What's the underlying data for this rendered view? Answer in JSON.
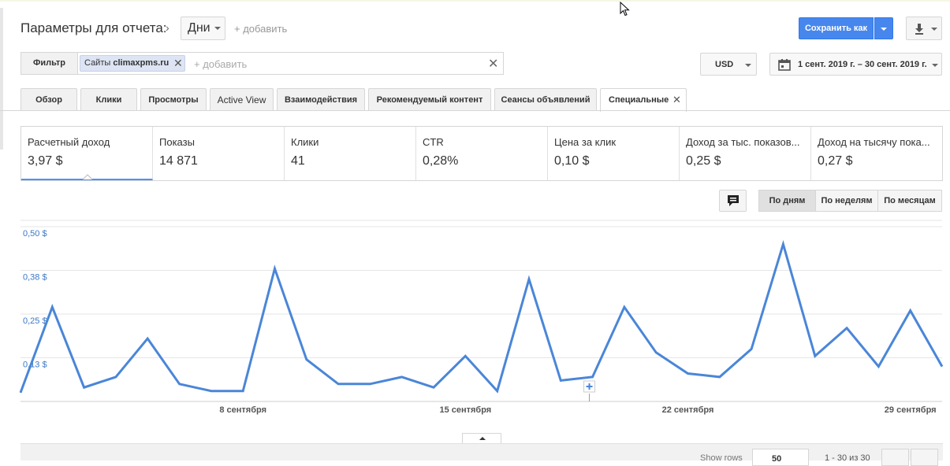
{
  "header": {
    "title": "Параметры для отчета:",
    "dimension": "Дни",
    "add_label": "+ добавить",
    "save_label": "Сохранить как"
  },
  "filter": {
    "label": "Фильтр",
    "chip_prefix": "Сайты",
    "chip_value": "climaxpms.ru",
    "add_label": "+ добавить"
  },
  "currency": "USD",
  "date_range": "1 сент. 2019 г. – 30 сент. 2019 г.",
  "tabs": [
    {
      "label": "Обзор"
    },
    {
      "label": "Клики"
    },
    {
      "label": "Просмотры"
    },
    {
      "label": "Active View"
    },
    {
      "label": "Взаимодействия"
    },
    {
      "label": "Рекомендуемый контент"
    },
    {
      "label": "Сеансы объявлений"
    },
    {
      "label": "Специальные"
    }
  ],
  "metrics": [
    {
      "name": "Расчетный доход",
      "value": "3,97 $"
    },
    {
      "name": "Показы",
      "value": "14 871"
    },
    {
      "name": "Клики",
      "value": "41"
    },
    {
      "name": "CTR",
      "value": "0,28%"
    },
    {
      "name": "Цена за клик",
      "value": "0,10 $"
    },
    {
      "name": "Доход за тыс. показов...",
      "value": "0,25 $"
    },
    {
      "name": "Доход на тысячу пока...",
      "value": "0,27 $"
    }
  ],
  "granularity": {
    "days": "По дням",
    "weeks": "По неделям",
    "months": "По месяцам"
  },
  "chart_data": {
    "type": "line",
    "ylim": [
      0,
      0.5
    ],
    "y_ticks": [
      "0,50 $",
      "0,38 $",
      "0,25 $",
      "0,13 $"
    ],
    "y_tick_values": [
      0.5,
      0.375,
      0.25,
      0.125
    ],
    "x_ticks": [
      "8 сентября",
      "15 сентября",
      "22 сентября",
      "29 сентября"
    ],
    "x_tick_days": [
      8,
      15,
      22,
      29
    ],
    "x": [
      1,
      2,
      3,
      4,
      5,
      6,
      7,
      8,
      9,
      10,
      11,
      12,
      13,
      14,
      15,
      16,
      17,
      18,
      19,
      20,
      21,
      22,
      23,
      24,
      25,
      26,
      27,
      28,
      29,
      30
    ],
    "values": [
      0.025,
      0.27,
      0.04,
      0.07,
      0.18,
      0.05,
      0.03,
      0.03,
      0.38,
      0.12,
      0.05,
      0.05,
      0.07,
      0.04,
      0.13,
      0.03,
      0.35,
      0.06,
      0.07,
      0.27,
      0.14,
      0.08,
      0.07,
      0.15,
      0.45,
      0.13,
      0.21,
      0.1,
      0.26,
      0.1
    ],
    "color": "#4a86d8",
    "grid": true
  },
  "footer": {
    "show_rows_label": "Show rows",
    "rows_value": "50",
    "range_text": "1 - 30 из 30"
  }
}
